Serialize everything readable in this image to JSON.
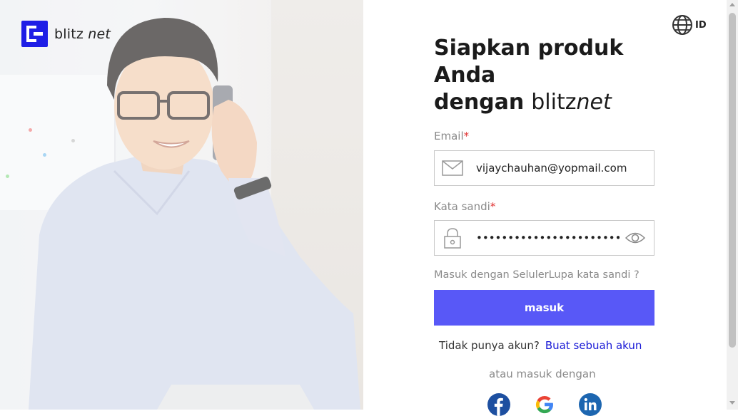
{
  "brand": {
    "logo_text_plain": "blitz",
    "logo_text_italic": "net"
  },
  "language": {
    "code": "ID",
    "icon": "globe-icon"
  },
  "heading": {
    "line1": "Siapkan produk",
    "line2": "Anda",
    "line3": "dengan",
    "brand_plain": "blitz",
    "brand_italic": "net"
  },
  "form": {
    "email_label": "Email",
    "email_value": "vijaychauhan@yopmail.com",
    "password_label": "Kata sandi",
    "password_value": "passwordpassword12345678",
    "required_mark": "*",
    "mobile_login_link": "Masuk dengan Seluler",
    "forgot_link": "Lupa kata sandi ?",
    "submit_label": "masuk",
    "no_account_text": "Tidak punya akun?",
    "create_account_link": "Buat sebuah akun",
    "alt_login_text": "atau masuk dengan"
  },
  "social": [
    "facebook-icon",
    "google-icon",
    "linkedin-icon"
  ],
  "colors": {
    "primary_button": "#5858f7",
    "logo": "#1e1ee6",
    "link": "#1919d6",
    "required": "#e03131"
  }
}
